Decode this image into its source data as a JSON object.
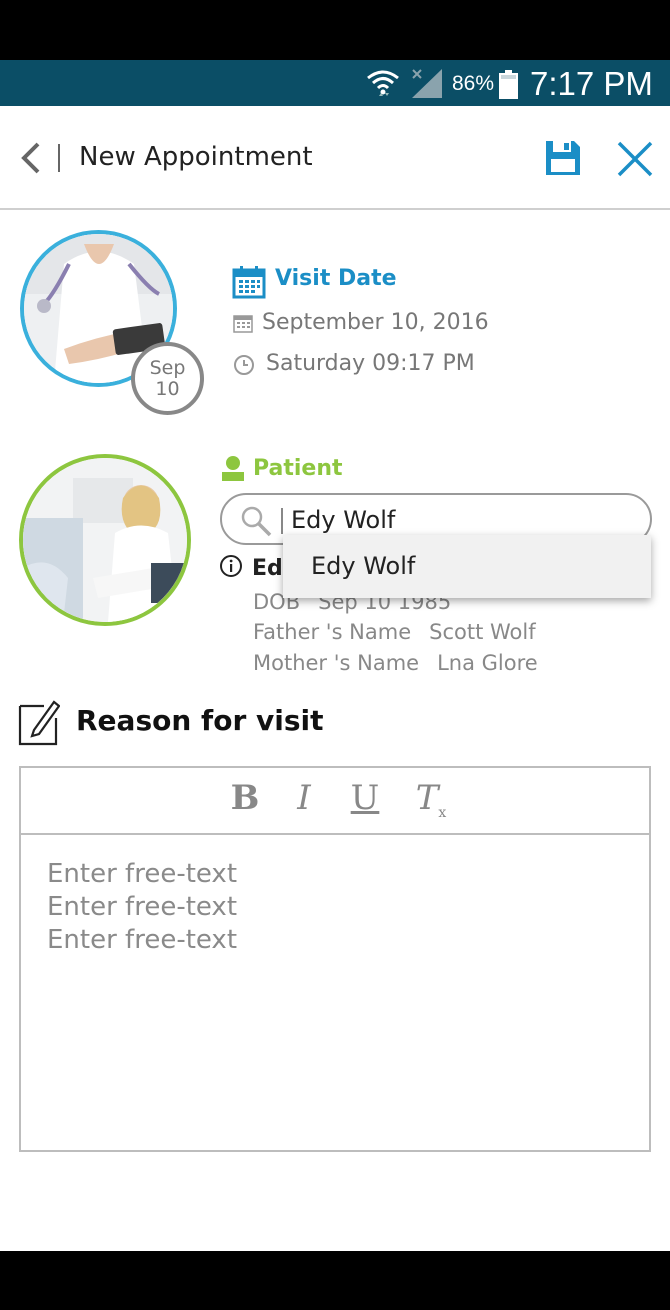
{
  "status_bar": {
    "battery_percent": "86%",
    "time": "7:17 PM"
  },
  "header": {
    "title": "New Appointment"
  },
  "visit_date": {
    "title": "Visit Date",
    "date": "September 10, 2016",
    "time": "Saturday 09:17 PM",
    "badge_month": "Sep",
    "badge_day": "10"
  },
  "patient": {
    "title": "Patient",
    "search_value": "Edy Wolf",
    "suggestion": "Edy Wolf",
    "name_partial": "Ed",
    "dob_label": "DOB",
    "dob_value": "Sep 10 1985",
    "father_label": "Father 's Name",
    "father_value": "Scott Wolf",
    "mother_label": "Mother 's Name",
    "mother_value": "Lna Glore"
  },
  "reason": {
    "title": "Reason for visit",
    "toolbar": {
      "bold": "B",
      "italic": "I",
      "underline": "U",
      "clear": "T",
      "clear_sub": "x"
    },
    "lines": [
      "Enter free-text",
      "Enter free-text",
      "Enter free-text"
    ]
  },
  "colors": {
    "status_bar": "#0b4e66",
    "visit_accent": "#1b8ec6",
    "patient_accent": "#8dc63f"
  }
}
